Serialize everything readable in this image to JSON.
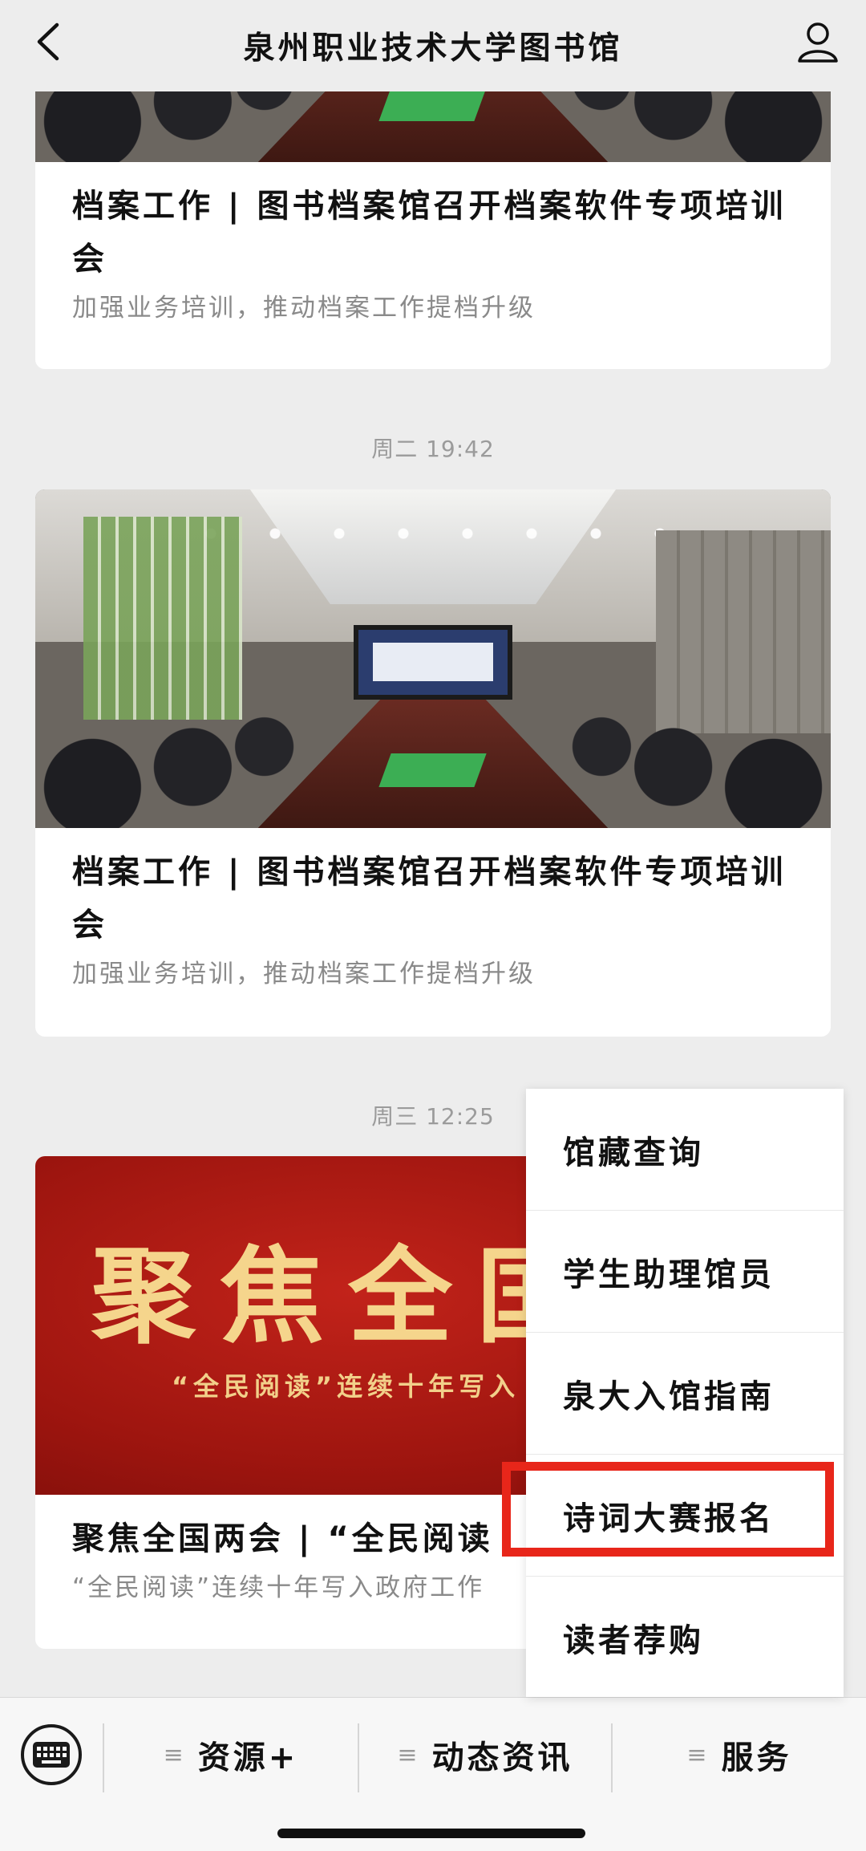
{
  "app": {
    "title": "泉州职业技术大学图书馆"
  },
  "feed": {
    "items": [
      {
        "headline": "档案工作 | 图书档案馆召开档案软件专项培训会",
        "subtitle": "加强业务培训，推动档案工作提档升级"
      },
      {
        "timestamp": "周二 19:42",
        "headline": "档案工作 | 图书档案馆召开档案软件专项培训会",
        "subtitle": "加强业务培训，推动档案工作提档升级"
      },
      {
        "timestamp": "周三 12:25",
        "banner_big": "聚焦全国",
        "banner_small": "“全民阅读”连续十年写入",
        "headline": "聚焦全国两会 | “全民阅读",
        "subtitle": "“全民阅读”连续十年写入政府工作"
      }
    ]
  },
  "popup_menu": {
    "items": [
      {
        "label": "馆藏查询"
      },
      {
        "label": "学生助理馆员"
      },
      {
        "label": "泉大入馆指南"
      },
      {
        "label": "诗词大赛报名",
        "highlighted": true
      },
      {
        "label": "读者荐购"
      }
    ],
    "highlight_color": "#e8261a"
  },
  "bottom_menu": {
    "keyboard_icon": "keyboard-icon",
    "hamburger_glyph": "≡",
    "items": [
      {
        "label": "资源+"
      },
      {
        "label": "动态资讯"
      },
      {
        "label": "服务"
      }
    ]
  },
  "icons": {
    "back": "chevron-left-icon",
    "profile": "person-icon"
  },
  "colors": {
    "background": "#ededed",
    "card": "#ffffff",
    "highlight": "#e8261a"
  }
}
